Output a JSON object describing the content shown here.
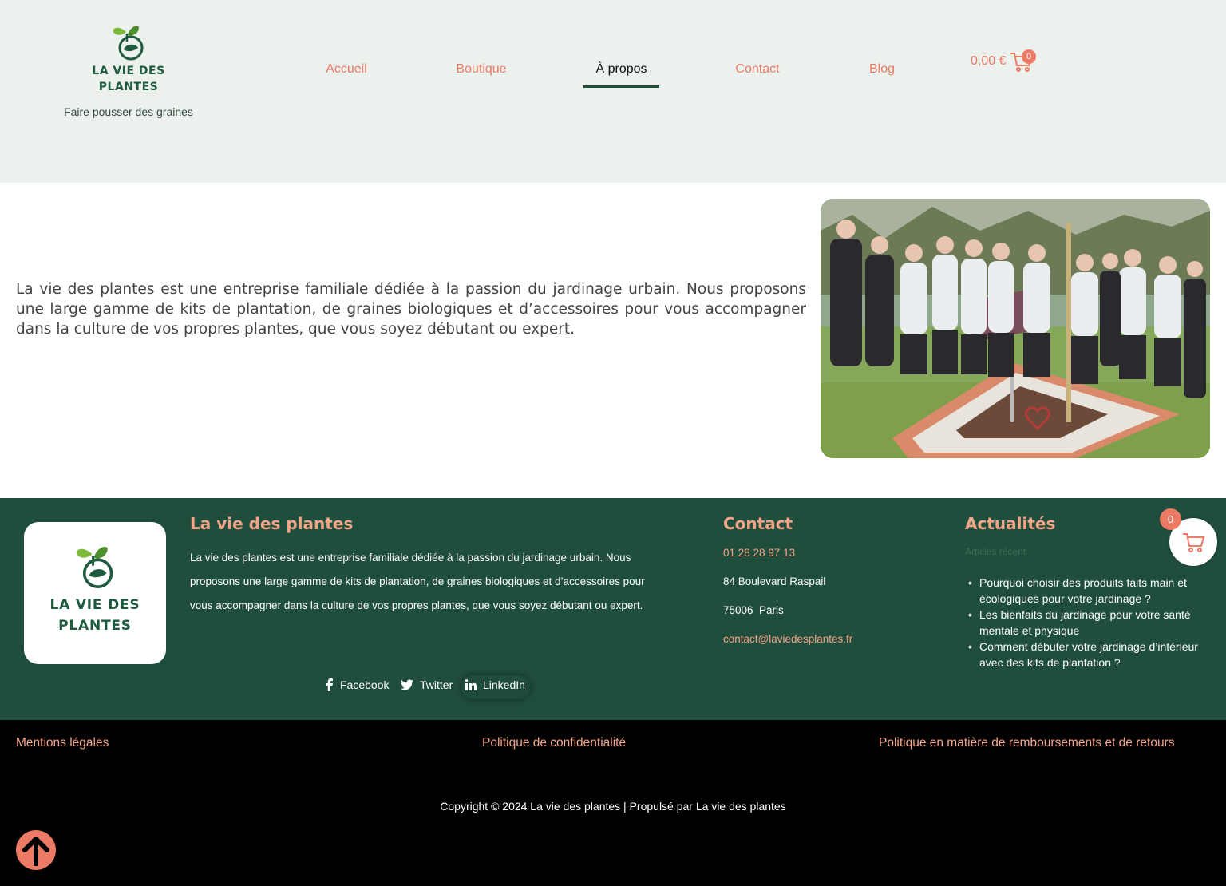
{
  "header": {
    "logo_line1": "LA VIE DES",
    "logo_line2": "PLANTES",
    "tagline": "Faire pousser des graines",
    "nav": [
      {
        "label": "Accueil",
        "active": false
      },
      {
        "label": "Boutique",
        "active": false
      },
      {
        "label": "À propos",
        "active": true
      },
      {
        "label": "Contact",
        "active": false
      },
      {
        "label": "Blog",
        "active": false
      }
    ],
    "cart_amount": "0,00 €",
    "cart_count": "0"
  },
  "main": {
    "intro": "La vie des plantes est une entreprise familiale dédiée à la passion du jardinage urbain. Nous proposons une large gamme de kits de plantation, de graines biologiques et d’accessoires pour vous accompagner dans la culture de vos propres plantes, que vous soyez débutant ou expert."
  },
  "footer": {
    "logo_line1": "LA VIE DES",
    "logo_line2": "PLANTES",
    "about_title": "La vie des plantes",
    "about_text": "La vie des plantes est une entreprise familiale dédiée à la passion du jardinage urbain. Nous proposons une large gamme de kits de plantation, de graines biologiques et d’accessoires pour vous accompagner dans la culture de vos propres plantes, que vous soyez débutant ou expert.",
    "social": {
      "facebook": "Facebook",
      "twitter": "Twitter",
      "linkedin": "LinkedIn"
    },
    "contact_title": "Contact",
    "phone": "01 28 28 97 13",
    "address1": "84 Boulevard Raspail",
    "address2": "75006  Paris",
    "email": "contact@laviedesplantes.fr",
    "news_title": "Actualités",
    "recent_label": "Articles récent",
    "news": [
      "Pourquoi choisir des produits faits main et écologiques pour votre jardinage ?",
      "Les bienfaits du jardinage pour votre santé mentale et physique",
      "Comment débuter votre jardinage d’intérieur avec des kits de plantation ?"
    ],
    "floating_cart_count": "0"
  },
  "bottom": {
    "legal": "Mentions légales",
    "privacy": "Politique de confidentialité",
    "refunds": "Politique en matière de remboursements et de retours",
    "copyright": "Copyright © 2024 La vie des plantes | Propulsé par La vie des plantes"
  },
  "colors": {
    "accent": "#ec7a65",
    "footer_green": "#204e3d",
    "header_bg": "#ecf1ed"
  }
}
